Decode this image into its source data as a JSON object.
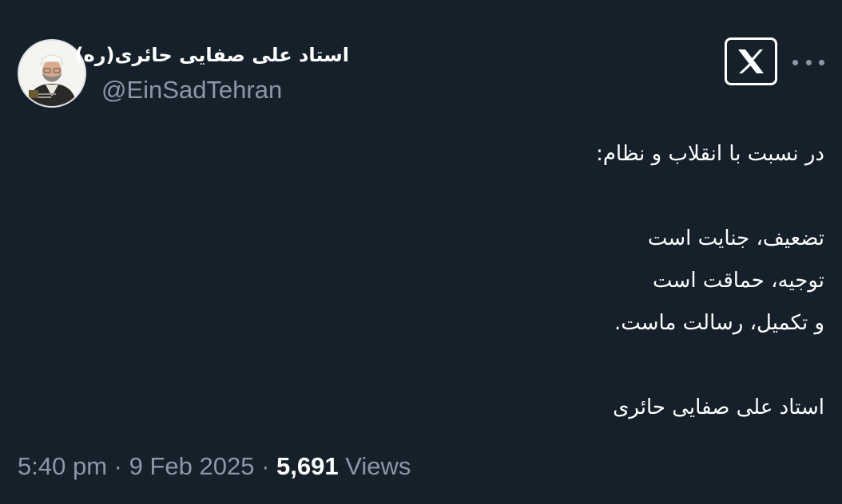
{
  "tweet": {
    "display_name": "استاد علی صفایی حائری(ره)",
    "handle": "@EinSadTehran",
    "text_lines": [
      "در نسبت با انقلاب و نظام:",
      "",
      "تضعیف، جنایت است",
      "توجیه، حماقت است",
      "و تکمیل، رسالت ماست.",
      "",
      "استاد علی صفایی حائری"
    ],
    "time": "5:40 pm",
    "separator": "·",
    "date": "9 Feb 2025",
    "views_count": "5,691",
    "views_label": "Views"
  },
  "icons": {
    "logo": "x-logo-icon",
    "more": "more-horizontal-icon"
  },
  "colors": {
    "background": "#15202b",
    "text_primary": "#ffffff",
    "text_secondary": "#8b98a5"
  }
}
